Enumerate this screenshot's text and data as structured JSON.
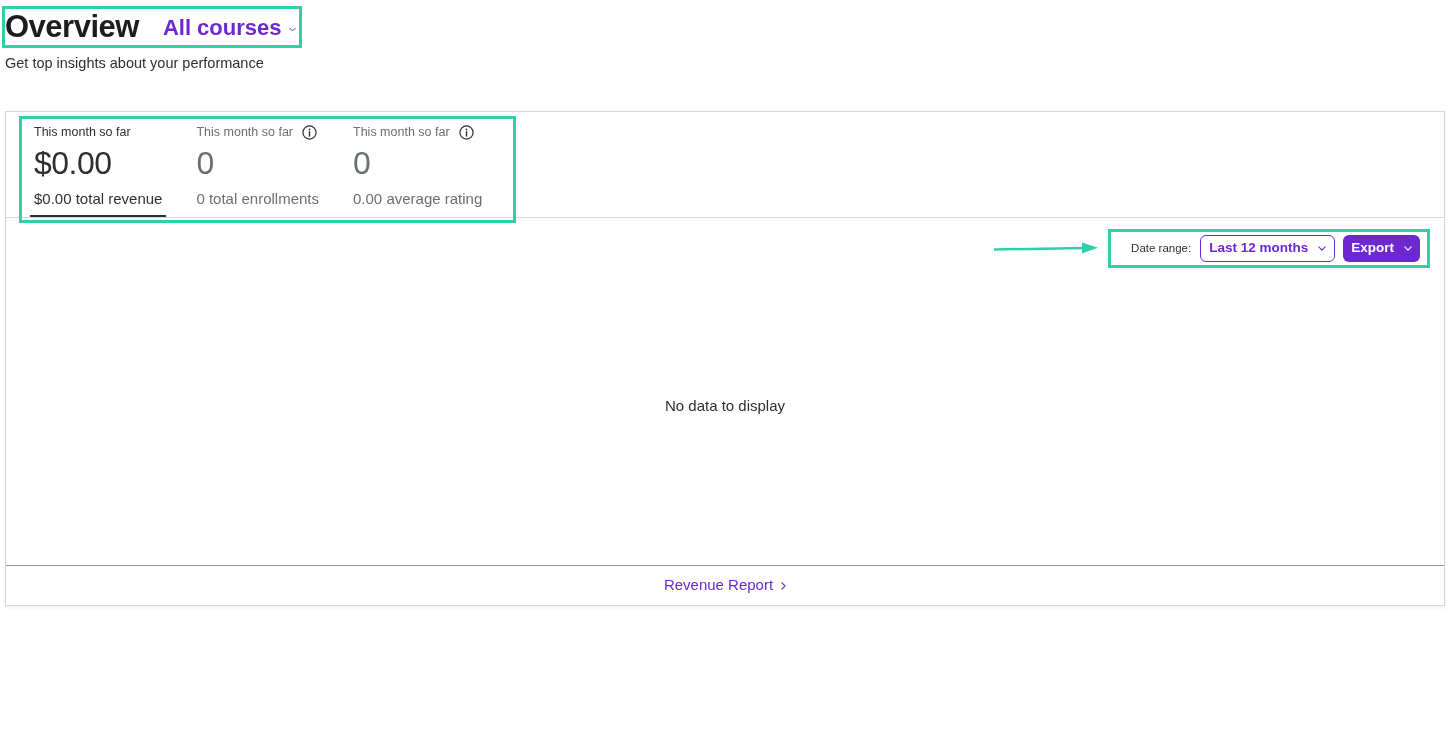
{
  "header": {
    "title": "Overview",
    "course_filter": "All courses",
    "highlighted": true
  },
  "subtitle": "Get top insights about your performance",
  "metrics": {
    "highlighted": true,
    "tabs": [
      {
        "label": "This month so far",
        "value": "$0.00",
        "caption": "$0.00 total revenue",
        "info": false,
        "selected": true
      },
      {
        "label": "This month so far",
        "value": "0",
        "caption": "0 total enrollments",
        "info": true,
        "selected": false
      },
      {
        "label": "This month so far",
        "value": "0",
        "caption": "0.00 average rating",
        "info": true,
        "selected": false
      }
    ]
  },
  "toolbar": {
    "highlighted": true,
    "arrow": true,
    "date_range_label": "Date range:",
    "date_range": "Last 12 months",
    "export_button": "Export"
  },
  "empty_message": "No data to display",
  "footer_link": "Revenue Report"
}
